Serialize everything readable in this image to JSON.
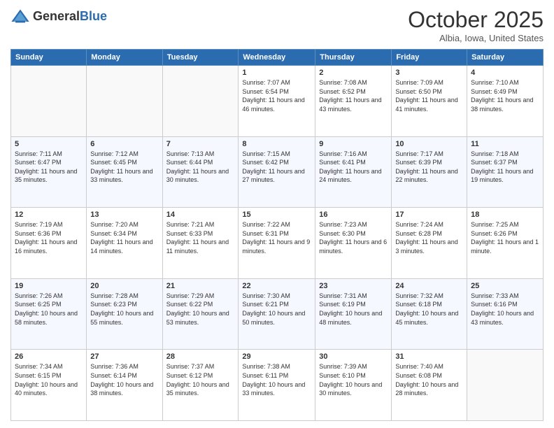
{
  "header": {
    "logo_general": "General",
    "logo_blue": "Blue",
    "month_title": "October 2025",
    "location": "Albia, Iowa, United States"
  },
  "days_of_week": [
    "Sunday",
    "Monday",
    "Tuesday",
    "Wednesday",
    "Thursday",
    "Friday",
    "Saturday"
  ],
  "weeks": [
    [
      {
        "day": "",
        "info": ""
      },
      {
        "day": "",
        "info": ""
      },
      {
        "day": "",
        "info": ""
      },
      {
        "day": "1",
        "info": "Sunrise: 7:07 AM\nSunset: 6:54 PM\nDaylight: 11 hours and 46 minutes."
      },
      {
        "day": "2",
        "info": "Sunrise: 7:08 AM\nSunset: 6:52 PM\nDaylight: 11 hours and 43 minutes."
      },
      {
        "day": "3",
        "info": "Sunrise: 7:09 AM\nSunset: 6:50 PM\nDaylight: 11 hours and 41 minutes."
      },
      {
        "day": "4",
        "info": "Sunrise: 7:10 AM\nSunset: 6:49 PM\nDaylight: 11 hours and 38 minutes."
      }
    ],
    [
      {
        "day": "5",
        "info": "Sunrise: 7:11 AM\nSunset: 6:47 PM\nDaylight: 11 hours and 35 minutes."
      },
      {
        "day": "6",
        "info": "Sunrise: 7:12 AM\nSunset: 6:45 PM\nDaylight: 11 hours and 33 minutes."
      },
      {
        "day": "7",
        "info": "Sunrise: 7:13 AM\nSunset: 6:44 PM\nDaylight: 11 hours and 30 minutes."
      },
      {
        "day": "8",
        "info": "Sunrise: 7:15 AM\nSunset: 6:42 PM\nDaylight: 11 hours and 27 minutes."
      },
      {
        "day": "9",
        "info": "Sunrise: 7:16 AM\nSunset: 6:41 PM\nDaylight: 11 hours and 24 minutes."
      },
      {
        "day": "10",
        "info": "Sunrise: 7:17 AM\nSunset: 6:39 PM\nDaylight: 11 hours and 22 minutes."
      },
      {
        "day": "11",
        "info": "Sunrise: 7:18 AM\nSunset: 6:37 PM\nDaylight: 11 hours and 19 minutes."
      }
    ],
    [
      {
        "day": "12",
        "info": "Sunrise: 7:19 AM\nSunset: 6:36 PM\nDaylight: 11 hours and 16 minutes."
      },
      {
        "day": "13",
        "info": "Sunrise: 7:20 AM\nSunset: 6:34 PM\nDaylight: 11 hours and 14 minutes."
      },
      {
        "day": "14",
        "info": "Sunrise: 7:21 AM\nSunset: 6:33 PM\nDaylight: 11 hours and 11 minutes."
      },
      {
        "day": "15",
        "info": "Sunrise: 7:22 AM\nSunset: 6:31 PM\nDaylight: 11 hours and 9 minutes."
      },
      {
        "day": "16",
        "info": "Sunrise: 7:23 AM\nSunset: 6:30 PM\nDaylight: 11 hours and 6 minutes."
      },
      {
        "day": "17",
        "info": "Sunrise: 7:24 AM\nSunset: 6:28 PM\nDaylight: 11 hours and 3 minutes."
      },
      {
        "day": "18",
        "info": "Sunrise: 7:25 AM\nSunset: 6:26 PM\nDaylight: 11 hours and 1 minute."
      }
    ],
    [
      {
        "day": "19",
        "info": "Sunrise: 7:26 AM\nSunset: 6:25 PM\nDaylight: 10 hours and 58 minutes."
      },
      {
        "day": "20",
        "info": "Sunrise: 7:28 AM\nSunset: 6:23 PM\nDaylight: 10 hours and 55 minutes."
      },
      {
        "day": "21",
        "info": "Sunrise: 7:29 AM\nSunset: 6:22 PM\nDaylight: 10 hours and 53 minutes."
      },
      {
        "day": "22",
        "info": "Sunrise: 7:30 AM\nSunset: 6:21 PM\nDaylight: 10 hours and 50 minutes."
      },
      {
        "day": "23",
        "info": "Sunrise: 7:31 AM\nSunset: 6:19 PM\nDaylight: 10 hours and 48 minutes."
      },
      {
        "day": "24",
        "info": "Sunrise: 7:32 AM\nSunset: 6:18 PM\nDaylight: 10 hours and 45 minutes."
      },
      {
        "day": "25",
        "info": "Sunrise: 7:33 AM\nSunset: 6:16 PM\nDaylight: 10 hours and 43 minutes."
      }
    ],
    [
      {
        "day": "26",
        "info": "Sunrise: 7:34 AM\nSunset: 6:15 PM\nDaylight: 10 hours and 40 minutes."
      },
      {
        "day": "27",
        "info": "Sunrise: 7:36 AM\nSunset: 6:14 PM\nDaylight: 10 hours and 38 minutes."
      },
      {
        "day": "28",
        "info": "Sunrise: 7:37 AM\nSunset: 6:12 PM\nDaylight: 10 hours and 35 minutes."
      },
      {
        "day": "29",
        "info": "Sunrise: 7:38 AM\nSunset: 6:11 PM\nDaylight: 10 hours and 33 minutes."
      },
      {
        "day": "30",
        "info": "Sunrise: 7:39 AM\nSunset: 6:10 PM\nDaylight: 10 hours and 30 minutes."
      },
      {
        "day": "31",
        "info": "Sunrise: 7:40 AM\nSunset: 6:08 PM\nDaylight: 10 hours and 28 minutes."
      },
      {
        "day": "",
        "info": ""
      }
    ]
  ]
}
